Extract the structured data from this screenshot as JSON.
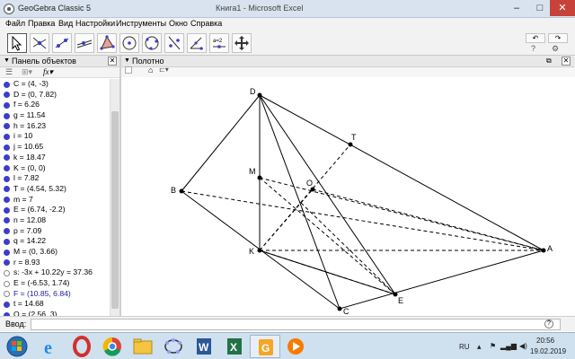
{
  "window": {
    "title": "GeoGebra Classic 5",
    "doc_title": "Книга1 - Microsoft Excel",
    "minimize": "–",
    "maximize": "□",
    "close": "✕"
  },
  "menu": [
    "Файл",
    "Правка",
    "Вид",
    "Настройки",
    "Инструменты",
    "Окно",
    "Справка"
  ],
  "toolbar": {
    "tools": [
      "move-tool",
      "point-tool",
      "line-tool",
      "perpendicular-tool",
      "polygon-tool",
      "circle-tool",
      "conic-tool",
      "angle-tool",
      "reflect-tool",
      "slider-tool",
      "move-view-tool"
    ],
    "slider_label": "a=2",
    "undo": "↶",
    "redo": "↷",
    "help": "?",
    "settings": "⚙"
  },
  "algebra": {
    "title": "Панель объектов",
    "items": [
      {
        "text": "C = (4, -3)",
        "dot": "filled",
        "color": "black"
      },
      {
        "text": "D = (0, 7.82)",
        "dot": "filled",
        "color": "black"
      },
      {
        "text": "f = 6.26",
        "dot": "filled",
        "color": "black"
      },
      {
        "text": "g = 11.54",
        "dot": "filled",
        "color": "black"
      },
      {
        "text": "h = 16.23",
        "dot": "filled",
        "color": "black"
      },
      {
        "text": "i = 10",
        "dot": "filled",
        "color": "black"
      },
      {
        "text": "j = 10.65",
        "dot": "filled",
        "color": "black"
      },
      {
        "text": "k = 18.47",
        "dot": "filled",
        "color": "black"
      },
      {
        "text": "K = (0, 0)",
        "dot": "filled",
        "color": "black"
      },
      {
        "text": "l = 7.82",
        "dot": "filled",
        "color": "black"
      },
      {
        "text": "T = (4.54, 5.32)",
        "dot": "filled",
        "color": "black"
      },
      {
        "text": "m = 7",
        "dot": "filled",
        "color": "black"
      },
      {
        "text": "E = (6.74, -2.2)",
        "dot": "filled",
        "color": "black"
      },
      {
        "text": "n = 12.08",
        "dot": "filled",
        "color": "black"
      },
      {
        "text": "p = 7.09",
        "dot": "filled",
        "color": "black"
      },
      {
        "text": "q = 14.22",
        "dot": "filled",
        "color": "black"
      },
      {
        "text": "M = (0, 3.66)",
        "dot": "filled",
        "color": "black"
      },
      {
        "text": "r = 8.93",
        "dot": "filled",
        "color": "black"
      },
      {
        "text": "s: -3x + 10.22y = 37.36",
        "dot": "hollow",
        "color": "black"
      },
      {
        "text": "E = (-6.53, 1.74)",
        "dot": "hollow",
        "color": "black"
      },
      {
        "text": "F = (10.85, 6.84)",
        "dot": "hollow",
        "color": "blue"
      },
      {
        "text": "t = 14.68",
        "dot": "filled",
        "color": "black"
      },
      {
        "text": "O = (2.56, 3)",
        "dot": "filled",
        "color": "black"
      }
    ]
  },
  "graphics": {
    "title": "Полотно",
    "points": {
      "D": "D",
      "T": "T",
      "M": "M",
      "O": "O",
      "B": "B",
      "K": "K",
      "A": "A",
      "E": "E",
      "C": "C"
    }
  },
  "input": {
    "label": "Ввод:",
    "value": "",
    "help": "?"
  },
  "taskbar": {
    "apps": [
      "windows-start-icon",
      "internet-explorer-icon",
      "opera-icon",
      "chrome-icon",
      "file-explorer-icon",
      "geogebra-icon",
      "word-icon",
      "excel-icon",
      "geogebra-classic-icon",
      "media-player-icon"
    ],
    "language": "RU",
    "time": "20:56",
    "date": "19.02.2019"
  }
}
